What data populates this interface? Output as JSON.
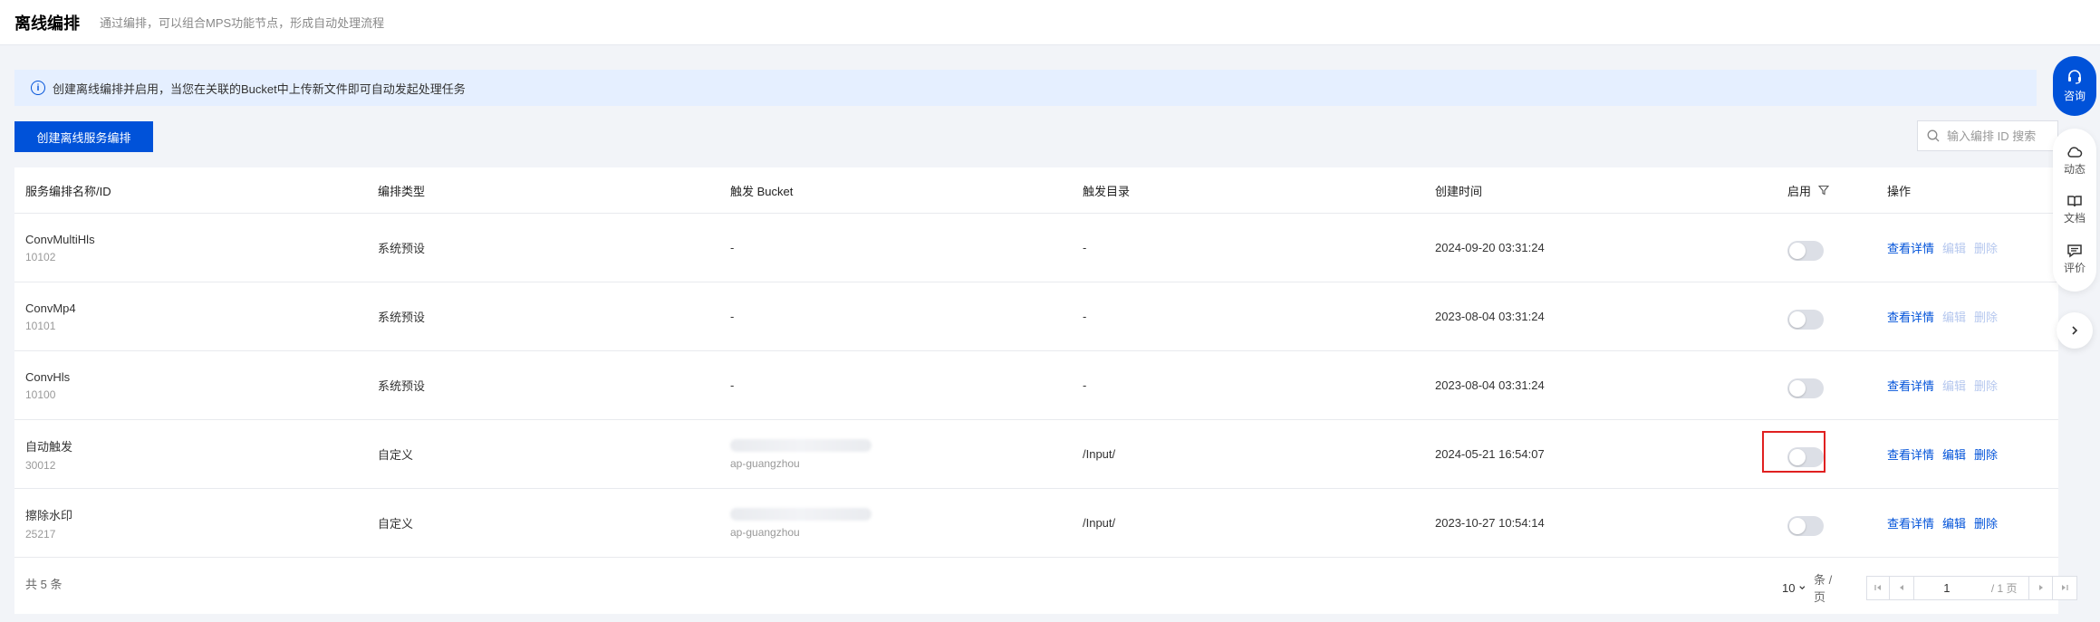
{
  "header": {
    "title": "离线编排",
    "subtitle": "通过编排，可以组合MPS功能节点，形成自动处理流程"
  },
  "notice": {
    "text": "创建离线编排并启用，当您在关联的Bucket中上传新文件即可自动发起处理任务"
  },
  "toolbar": {
    "create_label": "创建离线服务编排",
    "search_placeholder": "输入编排 ID 搜索"
  },
  "table": {
    "columns": [
      "服务编排名称/ID",
      "编排类型",
      "触发 Bucket",
      "触发目录",
      "创建时间",
      "启用",
      "操作"
    ],
    "rows": [
      {
        "name": "ConvMultiHls",
        "id": "10102",
        "type": "系统预设",
        "bucket": "-",
        "region": "",
        "dir": "-",
        "created": "2024-09-20 03:31:24",
        "enabled": false,
        "ops": [
          "查看详情",
          "编辑",
          "删除"
        ],
        "ops_enabled": [
          true,
          false,
          false
        ]
      },
      {
        "name": "ConvMp4",
        "id": "10101",
        "type": "系统预设",
        "bucket": "-",
        "region": "",
        "dir": "-",
        "created": "2023-08-04 03:31:24",
        "enabled": false,
        "ops": [
          "查看详情",
          "编辑",
          "删除"
        ],
        "ops_enabled": [
          true,
          false,
          false
        ]
      },
      {
        "name": "ConvHls",
        "id": "10100",
        "type": "系统预设",
        "bucket": "-",
        "region": "",
        "dir": "-",
        "created": "2023-08-04 03:31:24",
        "enabled": false,
        "ops": [
          "查看详情",
          "编辑",
          "删除"
        ],
        "ops_enabled": [
          true,
          false,
          false
        ]
      },
      {
        "name": "自动触发",
        "id": "30012",
        "type": "自定义",
        "bucket": "",
        "region": "ap-guangzhou",
        "dir": "/Input/",
        "created": "2024-05-21 16:54:07",
        "enabled": false,
        "highlighted": true,
        "ops": [
          "查看详情",
          "编辑",
          "删除"
        ],
        "ops_enabled": [
          true,
          true,
          true
        ]
      },
      {
        "name": "擦除水印",
        "id": "25217",
        "type": "自定义",
        "bucket": "",
        "region": "ap-guangzhou",
        "dir": "/Input/",
        "created": "2023-10-27 10:54:14",
        "enabled": false,
        "ops": [
          "查看详情",
          "编辑",
          "删除"
        ],
        "ops_enabled": [
          true,
          true,
          true
        ]
      }
    ]
  },
  "footer": {
    "total": "共 5 条",
    "page_size": "10",
    "page_size_unit": "条 / 页",
    "current_page": "1",
    "total_pages": "/ 1 页"
  },
  "float": {
    "consult": "咨询",
    "items": [
      "动态",
      "文档",
      "评价"
    ]
  },
  "colors": {
    "primary": "#0052d9",
    "disabled_link": "#b5c7ee",
    "highlight": "#e02020"
  }
}
